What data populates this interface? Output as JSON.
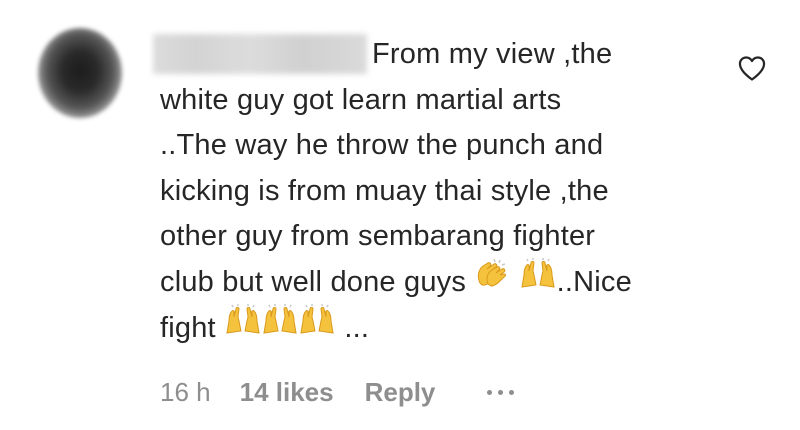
{
  "comment": {
    "username": "",
    "text_lines": [
      "From my view ,the",
      "white guy got learn martial arts",
      "..The way he throw the punch and",
      "kicking is from muay thai style ,the",
      "other guy from sembarang fighter",
      "club but well done guys",
      "..Nice",
      "fight",
      "..."
    ]
  },
  "meta": {
    "time": "16 h",
    "likes": "14 likes",
    "reply": "Reply"
  },
  "icons": {
    "like": "heart-outline-icon",
    "more": "more-options-icon",
    "emoji_1": "clapping-hands-emoji",
    "emoji_2": "raising-hands-emoji"
  },
  "colors": {
    "text": "#262626",
    "secondary": "#8e8e8e",
    "emoji": "#f5c23e"
  }
}
